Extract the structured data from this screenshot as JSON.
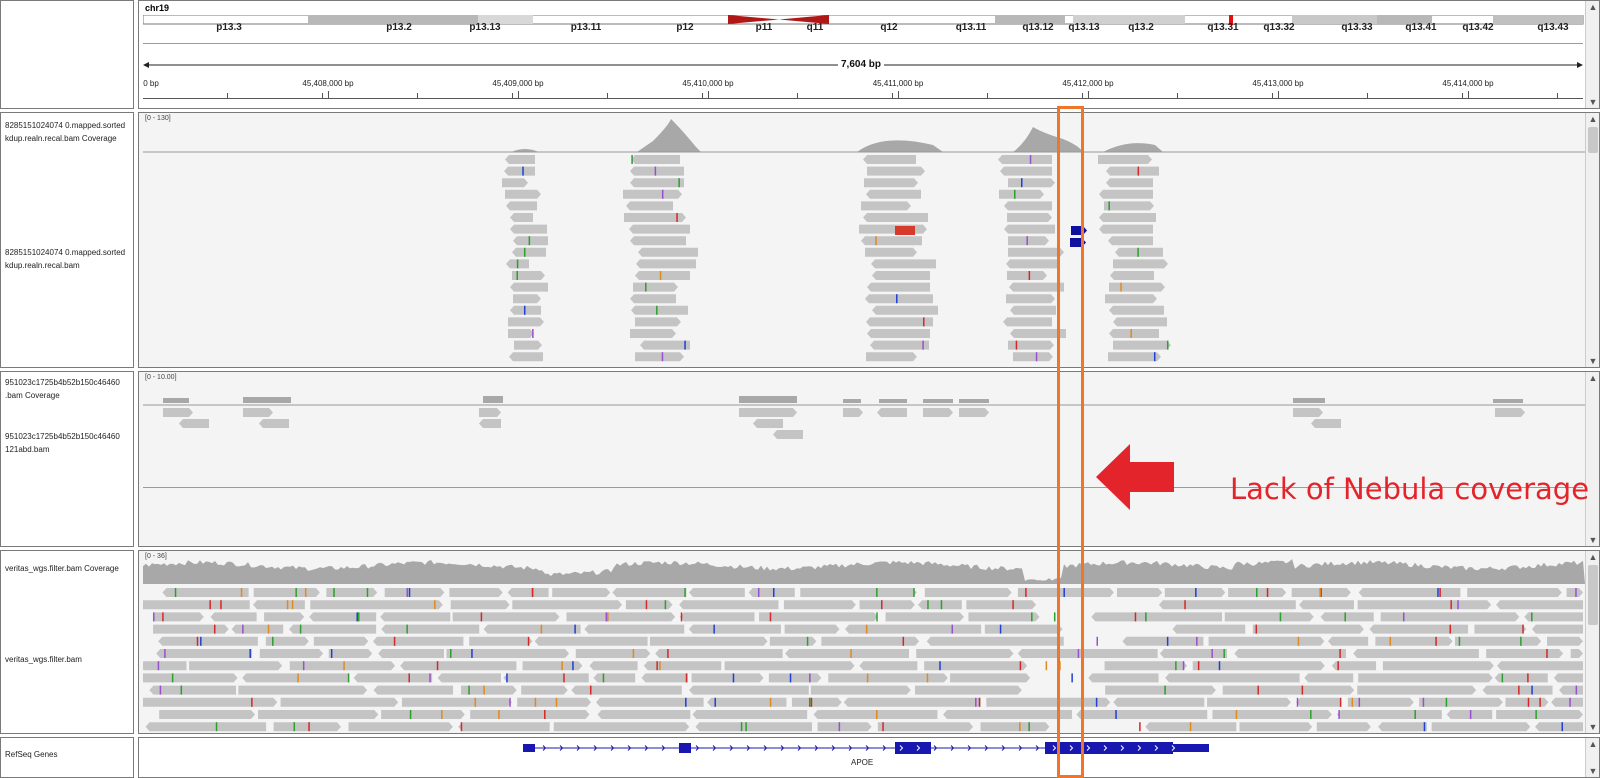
{
  "ideogram": {
    "chromosome": "chr19",
    "bands": [
      "p13.3",
      "p13.2",
      "p13.13",
      "p13.11",
      "p12",
      "p11",
      "q11",
      "q12",
      "q13.11",
      "q13.12",
      "q13.13",
      "q13.2",
      "q13.31",
      "q13.32",
      "q13.33",
      "q13.41",
      "q13.42",
      "q13.43"
    ]
  },
  "ruler": {
    "span": "7,604 bp",
    "start_label": "0 bp",
    "ticks": [
      "45,408,000 bp",
      "45,409,000 bp",
      "45,410,000 bp",
      "45,411,000 bp",
      "45,412,000 bp",
      "45,413,000 bp",
      "45,414,000 bp"
    ]
  },
  "tracks": {
    "nebula_coverage_name": "8285151024074 0.mapped.sorte d kdup.realn.recal.bam Coverage",
    "nebula_coverage_name_l1": "8285151024074 0.mapped.sorted",
    "nebula_coverage_name_l2": "kdup.realn.recal.bam Coverage",
    "nebula_bam_name_l1": "8285151024074 0.mapped.sorted",
    "nebula_bam_name_l2": "kdup.realn.recal.bam",
    "nebula_range": "[0 - 130]",
    "sample2_coverage_name_l1": "951023c1725b4b52b150c46460",
    "sample2_coverage_name_l2": ".bam Coverage",
    "sample2_bam_name_l1": "951023c1725b4b52b150c46460",
    "sample2_bam_name_l2": "121abd.bam",
    "sample2_range": "[0 - 10.00]",
    "veritas_coverage_name": "veritas_wgs.filter.bam Coverage",
    "veritas_bam_name": "veritas_wgs.filter.bam",
    "veritas_range": "[0 - 36]",
    "refseq_name": "RefSeq Genes",
    "gene_name": "APOE"
  },
  "annotation": {
    "text": "Lack of Nebula coverage",
    "color": "#e3242b",
    "highlight_color": "#f0742a"
  },
  "colors": {
    "read": "#c4c4c4",
    "coverage": "#a8a8a8",
    "gene": "#1818b0",
    "centromere": "#c01010"
  }
}
